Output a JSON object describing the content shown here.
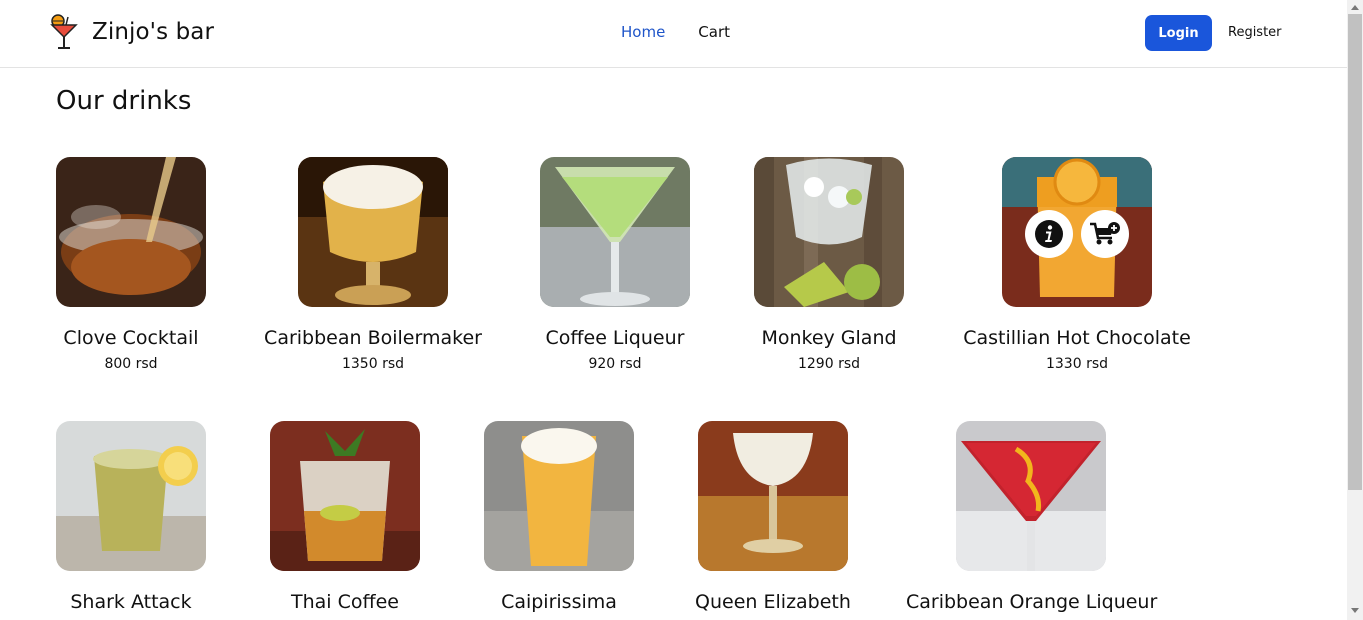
{
  "brand": {
    "name": "Zinjo's bar",
    "icon": "cocktail-glass-icon"
  },
  "nav": {
    "home": "Home",
    "cart": "Cart"
  },
  "auth": {
    "login": "Login",
    "register": "Register"
  },
  "colors": {
    "accent": "#1a56db",
    "active_link": "#1f55c9"
  },
  "page": {
    "title": "Our drinks"
  },
  "drinks": [
    {
      "name": "Clove Cocktail",
      "price": "800 rsd"
    },
    {
      "name": "Caribbean Boilermaker",
      "price": "1350 rsd"
    },
    {
      "name": "Coffee Liqueur",
      "price": "920 rsd"
    },
    {
      "name": "Monkey Gland",
      "price": "1290 rsd"
    },
    {
      "name": "Castillian Hot Chocolate",
      "price": "1330 rsd",
      "hovered": true,
      "actions": [
        "info-icon",
        "add-to-cart-icon"
      ]
    },
    {
      "name": "Shark Attack"
    },
    {
      "name": "Thai Coffee"
    },
    {
      "name": "Caipirissima"
    },
    {
      "name": "Queen Elizabeth"
    },
    {
      "name": "Caribbean Orange Liqueur"
    }
  ]
}
